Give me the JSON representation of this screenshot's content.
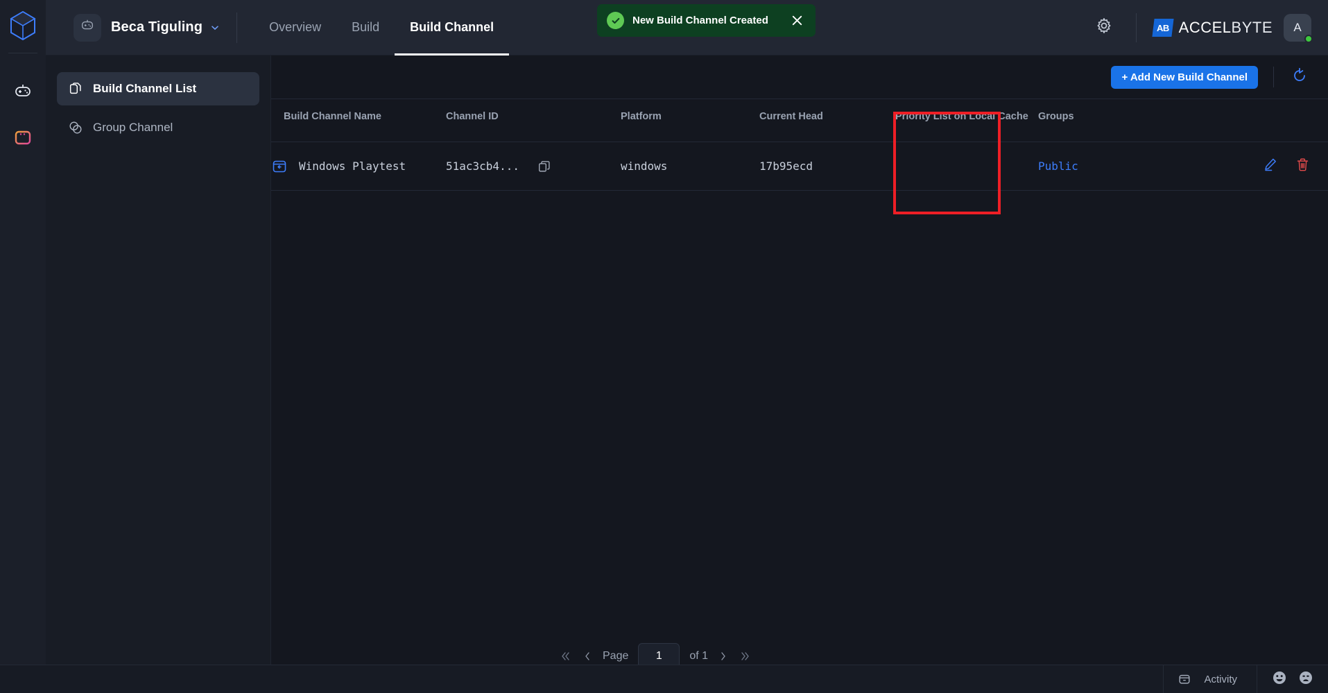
{
  "rail": {
    "logo_icon": "cube-logo-icon",
    "items": [
      {
        "icon": "game-controller-icon",
        "name": "rail-item-game"
      },
      {
        "icon": "store-window-icon",
        "name": "rail-item-store"
      }
    ]
  },
  "topbar": {
    "namespace_icon": "robot-icon",
    "namespace": "Beca Tiguling",
    "caret_icon": "chevron-down-icon",
    "tabs": [
      {
        "label": "Overview",
        "active": false
      },
      {
        "label": "Build",
        "active": false
      },
      {
        "label": "Build Channel",
        "active": true
      }
    ],
    "gear_icon": "gear-icon",
    "brand_mark": "AB",
    "brand_name_bold": "ACCEL",
    "brand_name_light": "BYTE",
    "avatar_initial": "A",
    "status_color": "#3ec93e"
  },
  "toast": {
    "icon": "check-circle-icon",
    "message": "New Build Channel Created",
    "close_icon": "close-icon",
    "bg_color": "#0d4021",
    "accent_color": "#5fc954"
  },
  "sidebar": {
    "items": [
      {
        "label": "Build Channel List",
        "icon": "documents-icon",
        "active": true
      },
      {
        "label": "Group Channel",
        "icon": "overlap-circles-icon",
        "active": false
      }
    ]
  },
  "toolbar": {
    "add_button": "+ Add New Build Channel",
    "add_button_color": "#1a73e8",
    "refresh_icon": "refresh-icon"
  },
  "table": {
    "columns": [
      "Build Channel Name",
      "Channel ID",
      "Platform",
      "Current Head",
      "Priority List on Local Cache",
      "Groups",
      ""
    ],
    "rows": [
      {
        "name": "Windows Playtest",
        "name_icon": "channel-icon",
        "channel_id": "51ac3cb4...",
        "copy_icon": "copy-icon",
        "platform": "windows",
        "current_head": "17b95ecd",
        "priority_list": "",
        "groups": "Public",
        "edit_icon": "pencil-icon",
        "delete_icon": "trash-icon"
      }
    ]
  },
  "highlight": {
    "color": "#ee1f26",
    "target": "groups-column"
  },
  "pagination": {
    "first_icon": "double-chevron-left-icon",
    "prev_icon": "chevron-left-icon",
    "page_label": "Page",
    "page_value": "1",
    "of_label": "of 1",
    "next_icon": "chevron-right-icon",
    "last_icon": "double-chevron-right-icon"
  },
  "statusbar": {
    "activity_icon": "panel-icon",
    "activity_label": "Activity",
    "happy_icon": "smiley-happy-icon",
    "sad_icon": "smiley-sad-icon"
  }
}
